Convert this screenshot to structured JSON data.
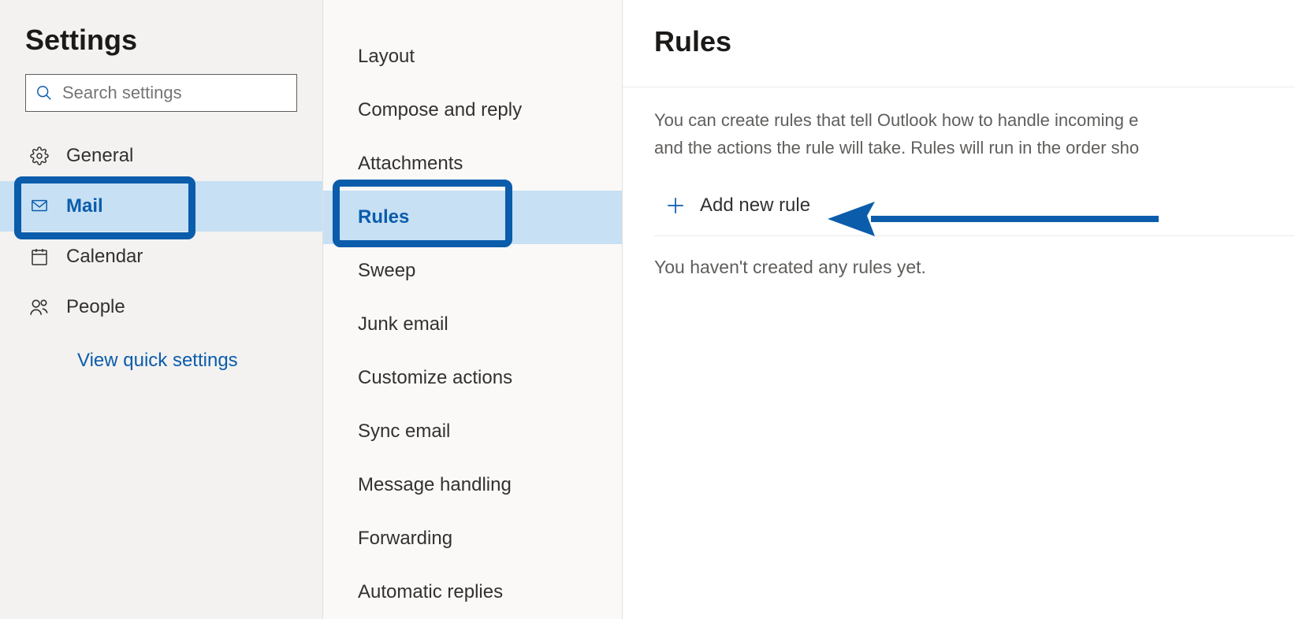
{
  "sidebar": {
    "title": "Settings",
    "search_placeholder": "Search settings",
    "items": [
      {
        "label": "General",
        "icon": "gear"
      },
      {
        "label": "Mail",
        "icon": "mail",
        "selected": true
      },
      {
        "label": "Calendar",
        "icon": "calendar"
      },
      {
        "label": "People",
        "icon": "people"
      }
    ],
    "quick_link": "View quick settings"
  },
  "subnav": {
    "items": [
      {
        "label": "Layout"
      },
      {
        "label": "Compose and reply"
      },
      {
        "label": "Attachments"
      },
      {
        "label": "Rules",
        "selected": true
      },
      {
        "label": "Sweep"
      },
      {
        "label": "Junk email"
      },
      {
        "label": "Customize actions"
      },
      {
        "label": "Sync email"
      },
      {
        "label": "Message handling"
      },
      {
        "label": "Forwarding"
      },
      {
        "label": "Automatic replies"
      }
    ]
  },
  "main": {
    "title": "Rules",
    "description_line1": "You can create rules that tell Outlook how to handle incoming e",
    "description_line2": "and the actions the rule will take. Rules will run in the order sho",
    "add_button": "Add new rule",
    "empty_message": "You haven't created any rules yet."
  },
  "colors": {
    "accent": "#0b5cab",
    "selected_bg": "#c7e0f4"
  }
}
